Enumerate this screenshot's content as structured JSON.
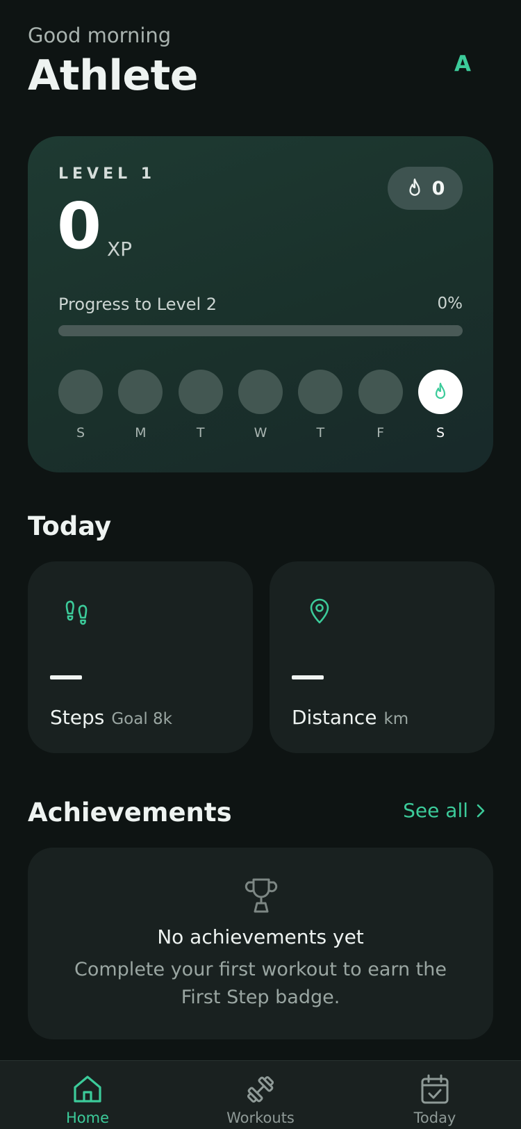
{
  "header": {
    "greeting": "Good morning",
    "name": "Athlete",
    "avatar_initial": "A"
  },
  "level_card": {
    "level_label": "LEVEL 1",
    "xp_value": "0",
    "xp_unit": "XP",
    "streak_count": "0",
    "progress_label": "Progress to Level 2",
    "progress_percent_text": "0%",
    "progress_fraction": 0,
    "days": [
      {
        "letter": "S",
        "active": false
      },
      {
        "letter": "M",
        "active": false
      },
      {
        "letter": "T",
        "active": false
      },
      {
        "letter": "W",
        "active": false
      },
      {
        "letter": "T",
        "active": false
      },
      {
        "letter": "F",
        "active": false
      },
      {
        "letter": "S",
        "active": true
      }
    ]
  },
  "today": {
    "title": "Today",
    "steps": {
      "label": "Steps",
      "sub": "Goal 8k",
      "icon": "footsteps-icon"
    },
    "distance": {
      "label": "Distance",
      "sub": "km",
      "icon": "location-pin-icon"
    }
  },
  "achievements": {
    "title": "Achievements",
    "see_all": "See all",
    "empty_title": "No achievements yet",
    "empty_desc": "Complete your first workout to earn the First Step badge."
  },
  "tabs": [
    {
      "label": "Home",
      "icon": "home-icon",
      "active": true
    },
    {
      "label": "Workouts",
      "icon": "dumbbell-icon",
      "active": false
    },
    {
      "label": "Today",
      "icon": "calendar-check-icon",
      "active": false
    }
  ],
  "colors": {
    "accent": "#3ccb9a",
    "background": "#0e1413",
    "card": "#192120"
  }
}
